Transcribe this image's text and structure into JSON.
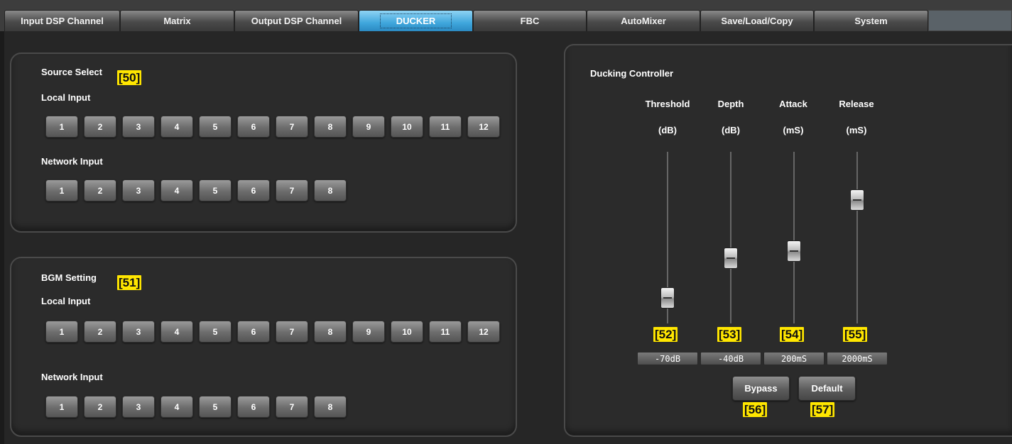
{
  "tabs": [
    {
      "label": "Input DSP Channel",
      "active": false
    },
    {
      "label": "Matrix",
      "active": false
    },
    {
      "label": "Output DSP Channel",
      "active": false
    },
    {
      "label": "DUCKER",
      "active": true
    },
    {
      "label": "FBC",
      "active": false
    },
    {
      "label": "AutoMixer",
      "active": false
    },
    {
      "label": "Save/Load/Copy",
      "active": false
    },
    {
      "label": "System",
      "active": false
    }
  ],
  "source_select": {
    "title": "Source Select",
    "tag": "[50]",
    "local_label": "Local Input",
    "local_buttons": [
      "1",
      "2",
      "3",
      "4",
      "5",
      "6",
      "7",
      "8",
      "9",
      "10",
      "11",
      "12"
    ],
    "network_label": "Network Input",
    "network_buttons": [
      "1",
      "2",
      "3",
      "4",
      "5",
      "6",
      "7",
      "8"
    ]
  },
  "bgm_setting": {
    "title": "BGM Setting",
    "tag": "[51]",
    "local_label": "Local Input",
    "local_buttons": [
      "1",
      "2",
      "3",
      "4",
      "5",
      "6",
      "7",
      "8",
      "9",
      "10",
      "11",
      "12"
    ],
    "network_label": "Network Input",
    "network_buttons": [
      "1",
      "2",
      "3",
      "4",
      "5",
      "6",
      "7",
      "8"
    ]
  },
  "ducking": {
    "title": "Ducking Controller",
    "sliders": [
      {
        "name": "Threshold",
        "unit": "(dB)",
        "value": "-70dB",
        "tag": "[52]",
        "level": 0.15
      },
      {
        "name": "Depth",
        "unit": "(dB)",
        "value": "-40dB",
        "tag": "[53]",
        "level": 0.38
      },
      {
        "name": "Attack",
        "unit": "(mS)",
        "value": "200mS",
        "tag": "[54]",
        "level": 0.42
      },
      {
        "name": "Release",
        "unit": "(mS)",
        "value": "2000mS",
        "tag": "[55]",
        "level": 0.72
      }
    ],
    "bypass_label": "Bypass",
    "bypass_tag": "[56]",
    "default_label": "Default",
    "default_tag": "[57]"
  }
}
